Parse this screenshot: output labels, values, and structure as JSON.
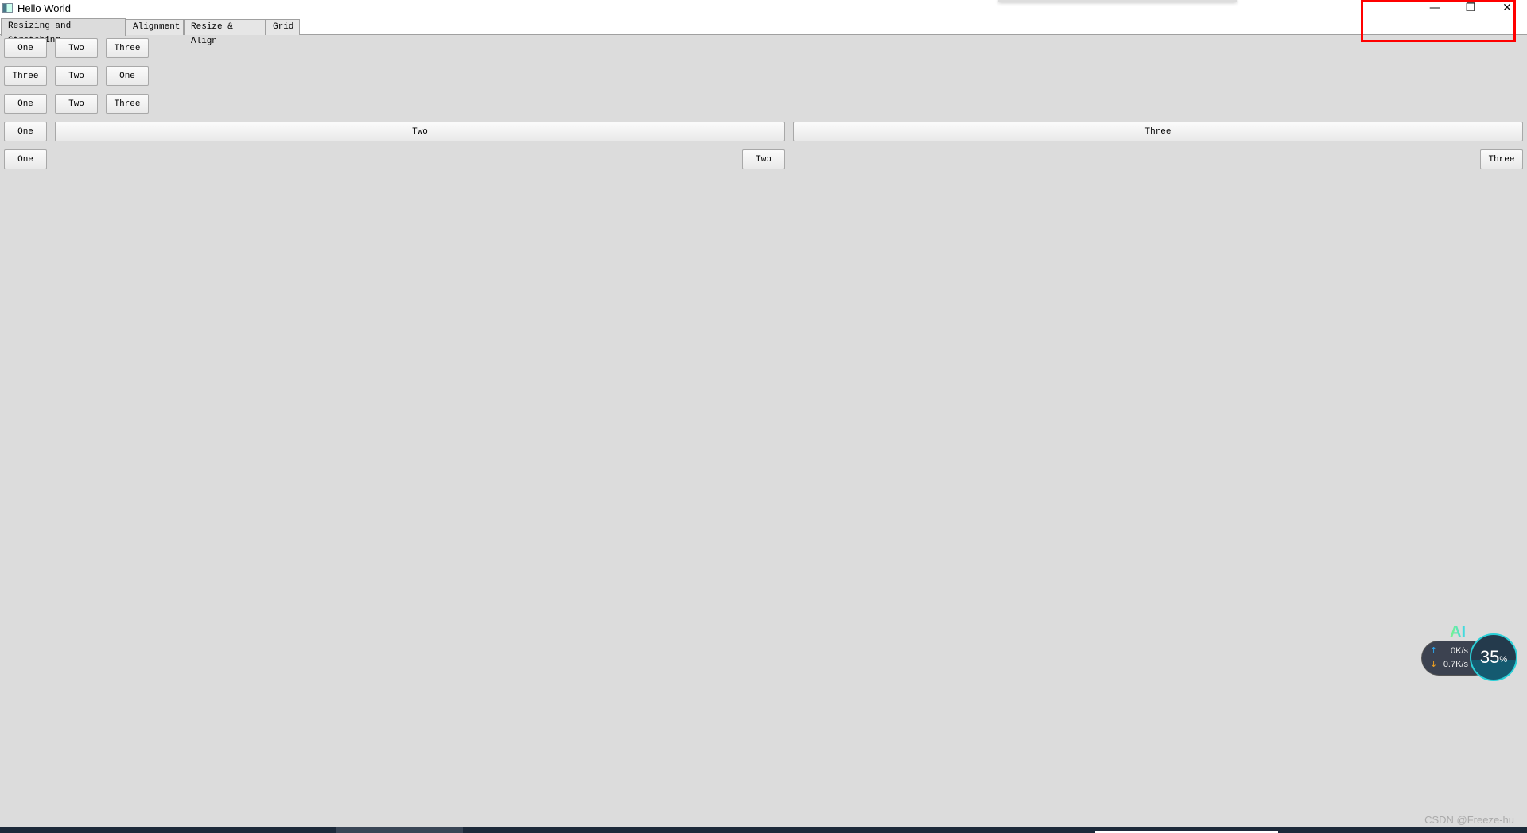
{
  "window": {
    "title": "Hello World",
    "minimize_icon": "minimize-icon",
    "restore_icon": "restore-icon",
    "close_icon": "close-icon"
  },
  "tabs": [
    {
      "label": "Resizing and Stretching",
      "active": true
    },
    {
      "label": "Alignment"
    },
    {
      "label": "Resize & Align"
    },
    {
      "label": "Grid"
    }
  ],
  "rows": [
    [
      "One",
      "Two",
      "Three"
    ],
    [
      "Three",
      "Two",
      "One"
    ],
    [
      "One",
      "Two",
      "Three"
    ],
    [
      "One",
      "Two",
      "Three"
    ],
    [
      "One",
      "Two",
      "Three"
    ]
  ],
  "widget": {
    "ai_label": "AI",
    "upload": "0K/s",
    "download": "0.7K/s",
    "cpu": "35",
    "cpu_unit": "%"
  },
  "watermark": "CSDN @Freeze-hu",
  "colors": {
    "highlight": "#ff0000",
    "background": "#dcdcdc"
  }
}
